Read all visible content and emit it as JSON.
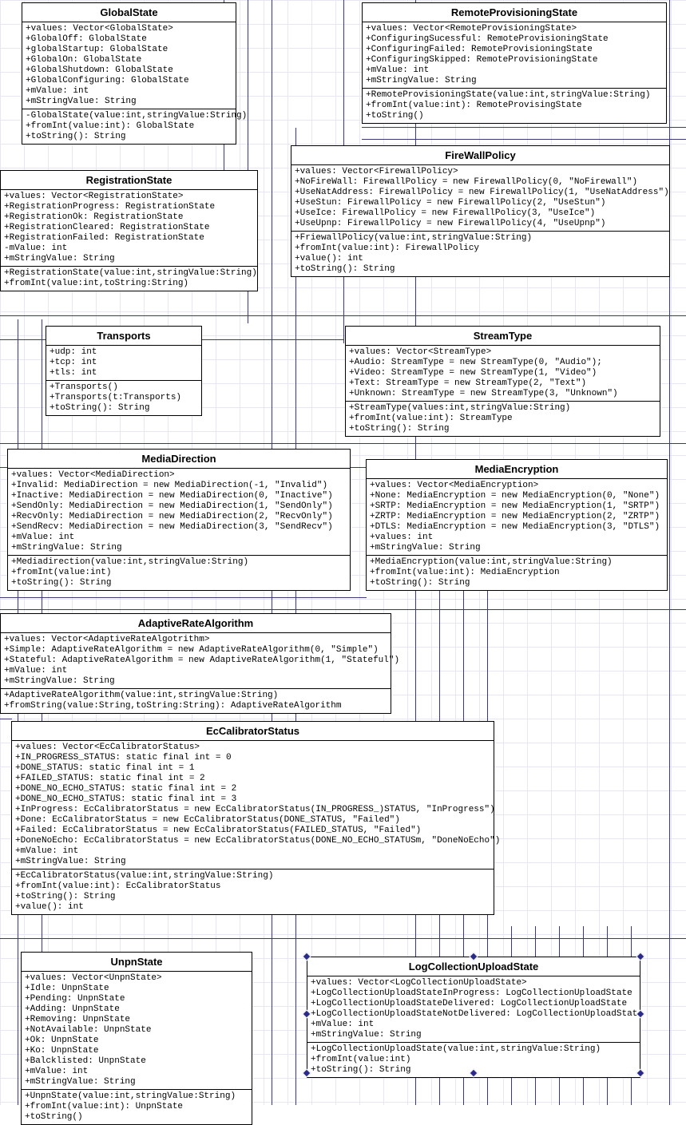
{
  "classes": {
    "GlobalState": {
      "title": "GlobalState",
      "attrs": [
        "+values: Vector<GlobalState>",
        "+GlobalOff: GlobalState",
        "+globalStartup: GlobalState",
        "+GlobalOn: GlobalState",
        "+GlobalShutdown: GlobalState",
        "+GlobalConfiguring: GlobalState",
        "+mValue: int",
        "+mStringValue: String"
      ],
      "ops": [
        "-GlobalState(value:int,stringValue:String)",
        "+fromInt(value:int): GlobalState",
        "+toString(): String"
      ]
    },
    "RemoteProvisioningState": {
      "title": "RemoteProvisioningState",
      "attrs": [
        "+values: Vector<RemoteProvisioningState>",
        "+ConfiguringSucessful: RemoteProvisioningState",
        "+ConfiguringFailed: RemoteProvisioningState",
        "+ConfiguringSkipped: RemoteProvisioningState",
        "+mValue: int",
        "+mStringValue: String"
      ],
      "ops": [
        "+RemoteProvisioningState(value:int,stringValue:String)",
        "+fromInt(value:int): RemoteProvisingState",
        "+toString()"
      ]
    },
    "RegistrationState": {
      "title": "RegistrationState",
      "attrs": [
        "+values: Vector<RegistrationState>",
        "+RegistrationProgress: RegistrationState",
        "+RegistrationOk: RegistrationState",
        "+RegistrationCleared: RegistrationState",
        "+RegistrationFailed: RegistrationState",
        "-mValue: int",
        "+mStringValue: String"
      ],
      "ops": [
        "+RegistrationState(value:int,stringValue:String)",
        "+fromInt(value:int,toString:String)"
      ]
    },
    "FireWallPolicy": {
      "title": "FireWallPolicy",
      "attrs": [
        "+values: Vector<FirewallPolicy>",
        "+NoFireWall: FirewallPolicy = new FirewallPolicy(0, \"NoFirewall\")",
        "+UseNatAddress: FirewallPolicy = new FirewallPolicy(1, \"UseNatAddress\")",
        "+UseStun: FirewallPolicy = new FirewallPolicy(2, \"UseStun\")",
        "+UseIce: FirewallPolicy = new FirewallPolicy(3, \"UseIce\")",
        "+UseUpnp: FirewallPolicy = new FirewallPolicy(4, \"UseUpnp\")"
      ],
      "ops": [
        "+FriewallPolicy(value:int,stringValue:String)",
        "+fromInt(value:int): FirewallPolicy",
        "+value(): int",
        "+toString(): String"
      ]
    },
    "Transports": {
      "title": "Transports",
      "attrs": [
        "+udp: int",
        "+tcp: int",
        "+tls: int"
      ],
      "ops": [
        "+Transports()",
        "+Transports(t:Transports)",
        "+toString(): String"
      ]
    },
    "StreamType": {
      "title": "StreamType",
      "attrs": [
        "+values: Vector<StreamType>",
        "+Audio: StreamType = new StreamType(0, \"Audio\");",
        "+Video: StreamType = new StreamType(1, \"Video\")",
        "+Text: StreamType = new StreamType(2, \"Text\")",
        "+Unknown: StreamType = new StreamType(3, \"Unknown\")"
      ],
      "ops": [
        "+StreamType(values:int,stringValue:String)",
        "+fromInt(value:int): StreamType",
        "+toString(): String"
      ]
    },
    "MediaDirection": {
      "title": "MediaDirection",
      "attrs": [
        "+values: Vector<MediaDirection>",
        "+Invalid: MediaDirection = new MediaDirection(-1, \"Invalid\")",
        "+Inactive: MediaDirection = new MediaDirection(0, \"Inactive\")",
        "+SendOnly: MediaDirection = new MediaDirection(1, \"SendOnly\")",
        "+RecvOnly: MediaDirection = new MediaDirection(2, \"RecvOnly\")",
        "+SendRecv: MediaDirection = new MediaDirection(3, \"SendRecv\")",
        "+mValue: int",
        "+mStringValue: String"
      ],
      "ops": [
        "+Mediadirection(value:int,stringValue:String)",
        "+fromInt(value:int)",
        "+toString(): String"
      ]
    },
    "MediaEncryption": {
      "title": "MediaEncryption",
      "attrs": [
        "+values: Vector<MediaEncryption>",
        "+None: MediaEncryption = new MediaEncryption(0, \"None\")",
        "+SRTP: MediaEncryption = new MediaEncryption(1, \"SRTP\")",
        "+ZRTP: MediaEncryption = new MediaEncryption(2, \"ZRTP\")",
        "+DTLS: MediaEncryption = new MediaEncryption(3, \"DTLS\")",
        "+values: int",
        "+mStringValue: String"
      ],
      "ops": [
        "+MediaEncryption(value:int,stringValue:String)",
        "+fromInt(value:int): MediaEncryption",
        "+toString(): String"
      ]
    },
    "AdaptiveRateAlgorithm": {
      "title": "AdaptiveRateAlgorithm",
      "attrs": [
        "+values: Vector<AdaptiveRateAlgotrithm>",
        "+Simple: AdaptiveRateAlgorithm = new AdaptiveRateAlgorithm(0, \"Simple\")",
        "+Stateful: AdaptiveRateAlgorithm = new AdaptiveRateAlgorithm(1, \"Stateful\")",
        "+mValue: int",
        "+mStringValue: String"
      ],
      "ops": [
        "+AdaptiveRateAlgorithm(value:int,stringValue:String)",
        "+fromString(value:String,toString:String): AdaptiveRateAlgorithm"
      ]
    },
    "EcCalibratorStatus": {
      "title": "EcCalibratorStatus",
      "attrs": [
        "+values: Vector<EcCalibratorStatus>",
        "+IN_PROGRESS_STATUS: static final int = 0",
        "+DONE_STATUS: static final int = 1",
        "+FAILED_STATUS: static final int = 2",
        "+DONE_NO_ECHO_STATUS: static final int = 2",
        "+DONE_NO_ECHO_STATUS: static final int = 3",
        "+InProgress: EcCalibratorStatus = new EcCalibratorStatus(IN_PROGRESS_)STATUS, \"InProgress\")",
        "+Done: EcCalibratorStatus = new EcCalibratorStatus(DONE_STATUS, \"Failed\")",
        "+Failed: EcCalibratorStatus = new EcCalibratorStatus(FAILED_STATUS, \"Failed\")",
        "+DoneNoEcho: EcCalibratorStatus = new EcCalibratorStatus(DONE_NO_ECHO_STATUSm, \"DoneNoEcho\")",
        "+mValue: int",
        "+mStringValue: String"
      ],
      "ops": [
        "+EcCalibratorStatus(value:int,stringValue:String)",
        "+fromInt(value:int): EcCalibratorStatus",
        "+toString(): String",
        "+value(): int"
      ]
    },
    "UnpnState": {
      "title": "UnpnState",
      "attrs": [
        "+values: Vector<UnpnState>",
        "+Idle: UnpnState",
        "+Pending: UnpnState",
        "+Adding: UnpnState",
        "+Removing: UnpnState",
        "+NotAvailable: UnpnState",
        "+Ok: UnpnState",
        "+Ko: UnpnState",
        "+Balcklisted: UnpnState",
        "+mValue: int",
        "+mStringValue: String"
      ],
      "ops": [
        "+UnpnState(value:int,stringValue:String)",
        "+fromInt(value:int): UnpnState",
        "+toString()"
      ]
    },
    "LogCollectionUploadState": {
      "title": "LogCollectionUploadState",
      "attrs": [
        "+values: Vector<LogCollectionUploadState>",
        "+LogCollectionUploadStateInProgress: LogCollectionUploadState",
        "+LogCollectionUploadStateDelivered: LogCollectionUploadState",
        "+LogCollectionUploadStateNotDelivered: LogCollectionUploadState",
        "+mValue: int",
        "+mStringValue: String"
      ],
      "ops": [
        "+LogCollectionUploadState(value:int,stringValue:String)",
        "+fromInt(value:int)",
        "+toString(): String"
      ]
    }
  }
}
